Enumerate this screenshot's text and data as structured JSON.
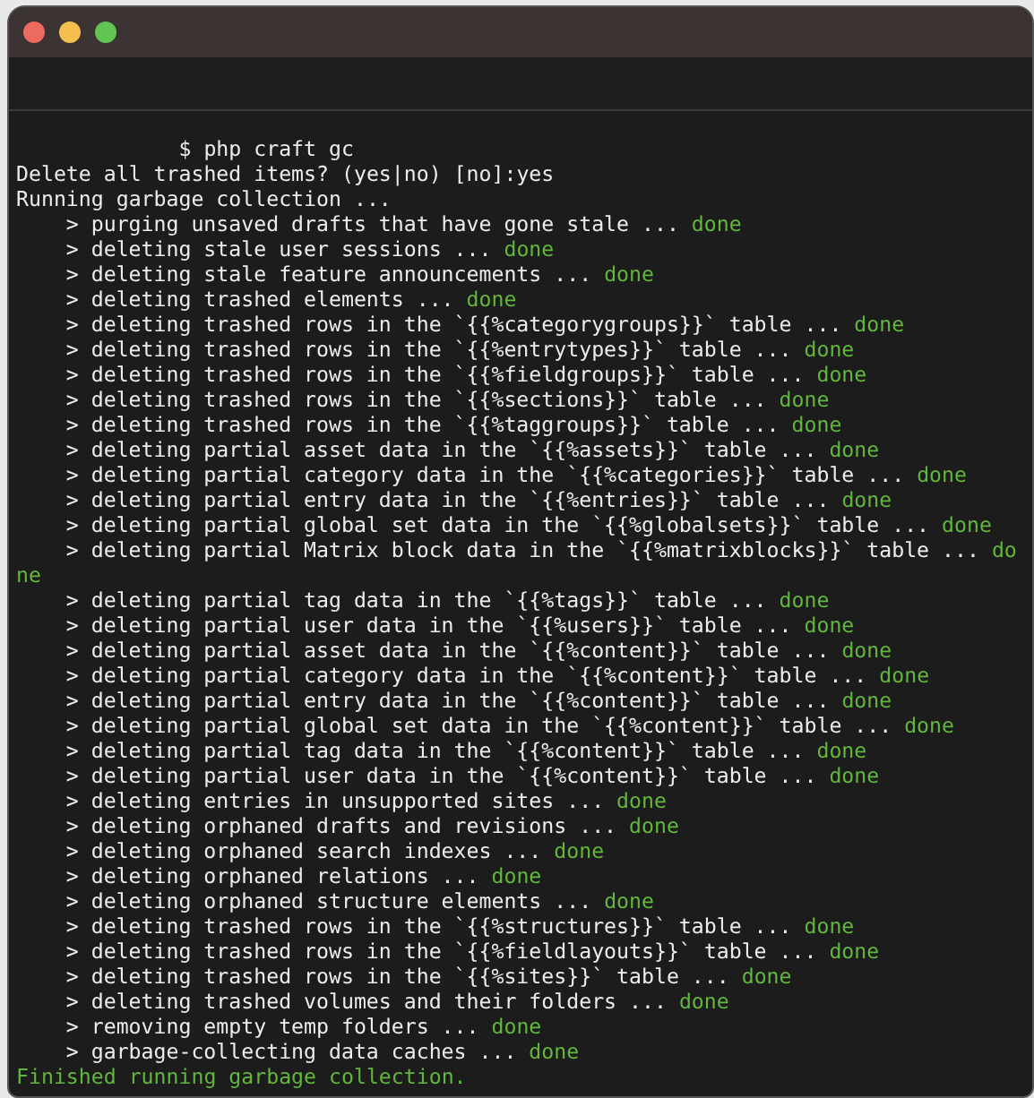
{
  "window": {
    "title_bar": {
      "buttons": [
        {
          "kind": "close"
        },
        {
          "kind": "minimize"
        },
        {
          "kind": "zoom"
        }
      ]
    }
  },
  "terminal": {
    "lines": [
      {
        "kind": "prompt",
        "text": "$ php craft gc"
      },
      {
        "kind": "plain",
        "text": "Delete all trashed items? (yes|no) [no]:yes"
      },
      {
        "kind": "plain",
        "text": "Running garbage collection ..."
      },
      {
        "kind": "step",
        "text": "> purging unsaved drafts that have gone stale ...",
        "status": "done"
      },
      {
        "kind": "step",
        "text": "> deleting stale user sessions ...",
        "status": "done"
      },
      {
        "kind": "step",
        "text": "> deleting stale feature announcements ...",
        "status": "done"
      },
      {
        "kind": "step",
        "text": "> deleting trashed elements ...",
        "status": "done"
      },
      {
        "kind": "step",
        "text": "> deleting trashed rows in the `{{%categorygroups}}` table ...",
        "status": "done"
      },
      {
        "kind": "step",
        "text": "> deleting trashed rows in the `{{%entrytypes}}` table ...",
        "status": "done"
      },
      {
        "kind": "step",
        "text": "> deleting trashed rows in the `{{%fieldgroups}}` table ...",
        "status": "done"
      },
      {
        "kind": "step",
        "text": "> deleting trashed rows in the `{{%sections}}` table ...",
        "status": "done"
      },
      {
        "kind": "step",
        "text": "> deleting trashed rows in the `{{%taggroups}}` table ...",
        "status": "done"
      },
      {
        "kind": "step",
        "text": "> deleting partial asset data in the `{{%assets}}` table ...",
        "status": "done"
      },
      {
        "kind": "step",
        "text": "> deleting partial category data in the `{{%categories}}` table ...",
        "status": "done"
      },
      {
        "kind": "step",
        "text": "> deleting partial entry data in the `{{%entries}}` table ...",
        "status": "done"
      },
      {
        "kind": "step",
        "text": "> deleting partial global set data in the `{{%globalsets}}` table ...",
        "status": "done"
      },
      {
        "kind": "step",
        "text": "> deleting partial Matrix block data in the `{{%matrixblocks}}` table ...",
        "status": "do"
      },
      {
        "kind": "wrap",
        "text": "ne"
      },
      {
        "kind": "step",
        "text": "> deleting partial tag data in the `{{%tags}}` table ...",
        "status": "done"
      },
      {
        "kind": "step",
        "text": "> deleting partial user data in the `{{%users}}` table ...",
        "status": "done"
      },
      {
        "kind": "step",
        "text": "> deleting partial asset data in the `{{%content}}` table ...",
        "status": "done"
      },
      {
        "kind": "step",
        "text": "> deleting partial category data in the `{{%content}}` table ...",
        "status": "done"
      },
      {
        "kind": "step",
        "text": "> deleting partial entry data in the `{{%content}}` table ...",
        "status": "done"
      },
      {
        "kind": "step",
        "text": "> deleting partial global set data in the `{{%content}}` table ...",
        "status": "done"
      },
      {
        "kind": "step",
        "text": "> deleting partial tag data in the `{{%content}}` table ...",
        "status": "done"
      },
      {
        "kind": "step",
        "text": "> deleting partial user data in the `{{%content}}` table ...",
        "status": "done"
      },
      {
        "kind": "step",
        "text": "> deleting entries in unsupported sites ...",
        "status": "done"
      },
      {
        "kind": "step",
        "text": "> deleting orphaned drafts and revisions ...",
        "status": "done"
      },
      {
        "kind": "step",
        "text": "> deleting orphaned search indexes ...",
        "status": "done"
      },
      {
        "kind": "step",
        "text": "> deleting orphaned relations ...",
        "status": "done"
      },
      {
        "kind": "step",
        "text": "> deleting orphaned structure elements ...",
        "status": "done"
      },
      {
        "kind": "step",
        "text": "> deleting trashed rows in the `{{%structures}}` table ...",
        "status": "done"
      },
      {
        "kind": "step",
        "text": "> deleting trashed rows in the `{{%fieldlayouts}}` table ...",
        "status": "done"
      },
      {
        "kind": "step",
        "text": "> deleting trashed rows in the `{{%sites}}` table ...",
        "status": "done"
      },
      {
        "kind": "step",
        "text": "> deleting trashed volumes and their folders ...",
        "status": "done"
      },
      {
        "kind": "step",
        "text": "> removing empty temp folders ...",
        "status": "done"
      },
      {
        "kind": "step",
        "text": "> garbage-collecting data caches ...",
        "status": "done"
      },
      {
        "kind": "success",
        "text": "Finished running garbage collection."
      }
    ]
  }
}
